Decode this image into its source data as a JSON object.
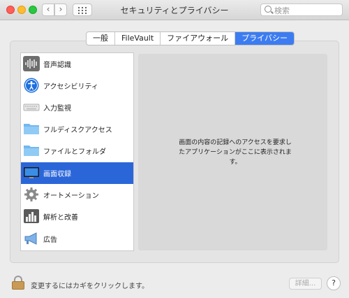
{
  "window": {
    "title": "セキュリティとプライバシー"
  },
  "search": {
    "placeholder": "検索"
  },
  "tabs": [
    {
      "label": "一般",
      "active": false
    },
    {
      "label": "FileVault",
      "active": false
    },
    {
      "label": "ファイアウォール",
      "active": false
    },
    {
      "label": "プライバシー",
      "active": true
    }
  ],
  "sidebar": {
    "items": [
      {
        "label": "音声認識",
        "icon": "waveform-icon",
        "selected": false
      },
      {
        "label": "アクセシビリティ",
        "icon": "accessibility-icon",
        "selected": false
      },
      {
        "label": "入力監視",
        "icon": "keyboard-icon",
        "selected": false
      },
      {
        "label": "フルディスクアクセス",
        "icon": "folder-icon",
        "selected": false
      },
      {
        "label": "ファイルとフォルダ",
        "icon": "folder-icon",
        "selected": false
      },
      {
        "label": "画面収録",
        "icon": "display-icon",
        "selected": true
      },
      {
        "label": "オートメーション",
        "icon": "gear-icon",
        "selected": false
      },
      {
        "label": "解析と改善",
        "icon": "bar-chart-icon",
        "selected": false
      },
      {
        "label": "広告",
        "icon": "megaphone-icon",
        "selected": false
      }
    ]
  },
  "detail": {
    "message": "画面の内容の記録へのアクセスを要求したアプリケーションがここに表示されます。"
  },
  "footer": {
    "lock_text": "変更するにはカギをクリックします。",
    "advanced_label": "詳細...",
    "help_label": "?"
  },
  "colors": {
    "accent": "#2b66d9",
    "tab_active": "#3d7cf0"
  }
}
